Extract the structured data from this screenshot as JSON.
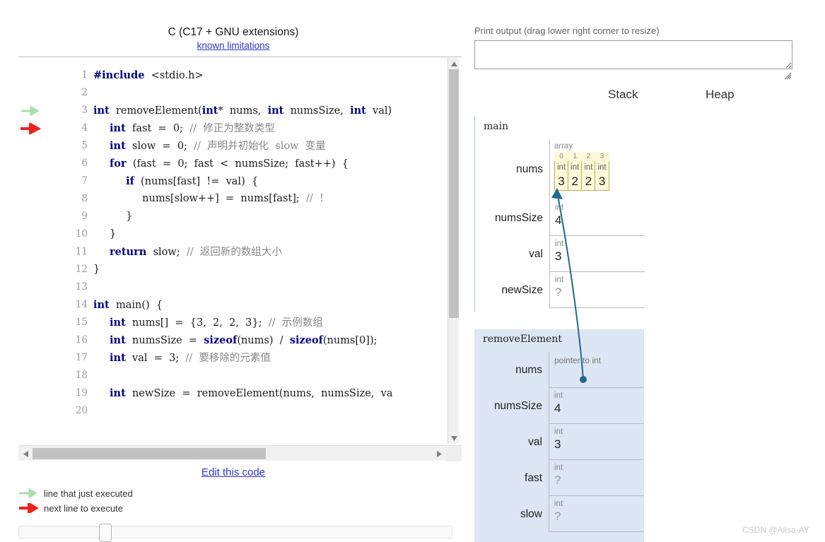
{
  "language": {
    "title": "C (C17 + GNU extensions)",
    "limitations_link": "known limitations"
  },
  "editor": {
    "edit_link": "Edit this code",
    "lines": [
      {
        "num": "1",
        "text": "#include  <stdio.h>",
        "marker": ""
      },
      {
        "num": "2",
        "text": "",
        "marker": ""
      },
      {
        "num": "3",
        "text": "int  removeElement(int*  nums,  int  numsSize,  int  val)",
        "marker": "just-executed"
      },
      {
        "num": "4",
        "text": "     int  fast  =  0;  //  修正为整数类型",
        "marker": "next-to-execute"
      },
      {
        "num": "5",
        "text": "     int  slow  =  0;  //  声明并初始化  slow  变量",
        "marker": ""
      },
      {
        "num": "6",
        "text": "     for  (fast  =  0;  fast  <  numsSize;  fast++)  {",
        "marker": ""
      },
      {
        "num": "7",
        "text": "          if  (nums[fast]  !=  val)  {",
        "marker": ""
      },
      {
        "num": "8",
        "text": "               nums[slow++]  =  nums[fast];  //  !",
        "marker": ""
      },
      {
        "num": "9",
        "text": "          }",
        "marker": ""
      },
      {
        "num": "10",
        "text": "     }",
        "marker": ""
      },
      {
        "num": "11",
        "text": "     return  slow;  //  返回新的数组大小",
        "marker": ""
      },
      {
        "num": "12",
        "text": "}",
        "marker": ""
      },
      {
        "num": "13",
        "text": "",
        "marker": ""
      },
      {
        "num": "14",
        "text": "int  main()  {",
        "marker": ""
      },
      {
        "num": "15",
        "text": "     int  nums[]  =  {3,  2,  2,  3};  //  示例数组",
        "marker": ""
      },
      {
        "num": "16",
        "text": "     int  numsSize  =  sizeof(nums)  /  sizeof(nums[0]);",
        "marker": ""
      },
      {
        "num": "17",
        "text": "     int  val  =  3;  //  要移除的元素值",
        "marker": ""
      },
      {
        "num": "18",
        "text": "",
        "marker": ""
      },
      {
        "num": "19",
        "text": "     int  newSize  =  removeElement(nums,  numsSize,  va",
        "marker": ""
      },
      {
        "num": "20",
        "text": "",
        "marker": ""
      }
    ]
  },
  "legend": [
    {
      "icon": "green-arrow-icon",
      "label": "line that just executed",
      "color": "#a8e0a8"
    },
    {
      "icon": "red-arrow-icon",
      "label": "next line to execute",
      "color": "#ee2222"
    }
  ],
  "print_output": {
    "label": "Print output (drag lower right corner to resize)",
    "value": ""
  },
  "columns": {
    "stack": "Stack",
    "heap": "Heap"
  },
  "frames": [
    {
      "name": "main",
      "variables": [
        {
          "name": "nums",
          "kind": "array",
          "array_label": "array",
          "indices": [
            "0",
            "1",
            "2",
            "3"
          ],
          "types": [
            "int",
            "int",
            "int",
            "int"
          ],
          "values": [
            "3",
            "2",
            "2",
            "3"
          ]
        },
        {
          "name": "numsSize",
          "kind": "scalar",
          "type": "int",
          "value": "4"
        },
        {
          "name": "val",
          "kind": "scalar",
          "type": "int",
          "value": "3"
        },
        {
          "name": "newSize",
          "kind": "scalar",
          "type": "int",
          "value": "?"
        }
      ]
    },
    {
      "name": "removeElement",
      "variables": [
        {
          "name": "nums",
          "kind": "pointer",
          "type": "pointer to int",
          "value": ""
        },
        {
          "name": "numsSize",
          "kind": "scalar",
          "type": "int",
          "value": "4"
        },
        {
          "name": "val",
          "kind": "scalar",
          "type": "int",
          "value": "3"
        },
        {
          "name": "fast",
          "kind": "scalar",
          "type": "int",
          "value": "?"
        },
        {
          "name": "slow",
          "kind": "scalar",
          "type": "int",
          "value": "?"
        }
      ]
    }
  ],
  "slider": {
    "position_percent": 19
  },
  "watermark": "CSDN @Alisa-AY",
  "colors": {
    "link": "#3333cc",
    "array_fill": "#fcf8d8",
    "array_border": "#b9b060",
    "active_frame": "#dde6f5",
    "pointer_line": "#1f6a8c",
    "green_arrow": "#a8e0a8",
    "red_arrow": "#ee2222"
  }
}
